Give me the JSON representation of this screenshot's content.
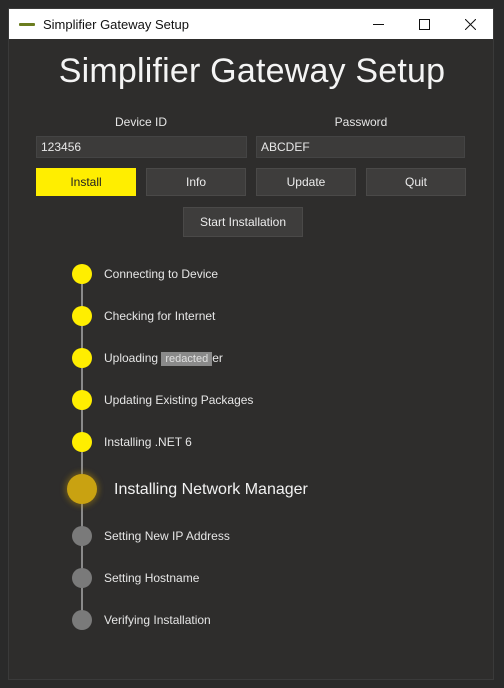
{
  "window": {
    "title": "Simplifier Gateway Setup",
    "controls": [
      "minimize-icon",
      "maximize-icon",
      "close-icon"
    ]
  },
  "app": {
    "heading": "Simplifier Gateway Setup"
  },
  "form": {
    "device_id_label": "Device ID",
    "device_id_value": "123456",
    "password_label": "Password",
    "password_value": "ABCDEF"
  },
  "buttons": {
    "install": "Install",
    "info": "Info",
    "update": "Update",
    "quit": "Quit",
    "start": "Start Installation"
  },
  "steps": [
    {
      "label": "Connecting to Device",
      "status": "done"
    },
    {
      "label": "Checking for Internet",
      "status": "done"
    },
    {
      "label_prefix": "Uploading",
      "label_redacted": "redacted",
      "label_suffix": "er",
      "status": "done"
    },
    {
      "label": "Updating Existing Packages",
      "status": "done"
    },
    {
      "label": "Installing .NET 6",
      "status": "done"
    },
    {
      "label": "Installing Network Manager",
      "status": "active"
    },
    {
      "label": "Setting New IP Address",
      "status": "pending"
    },
    {
      "label": "Setting Hostname",
      "status": "pending"
    },
    {
      "label": "Verifying Installation",
      "status": "pending"
    }
  ],
  "colors": {
    "accent": "#ffee00",
    "active_step": "#c9a211",
    "pending_step": "#7a7a7a",
    "background": "#2e2d2c"
  }
}
